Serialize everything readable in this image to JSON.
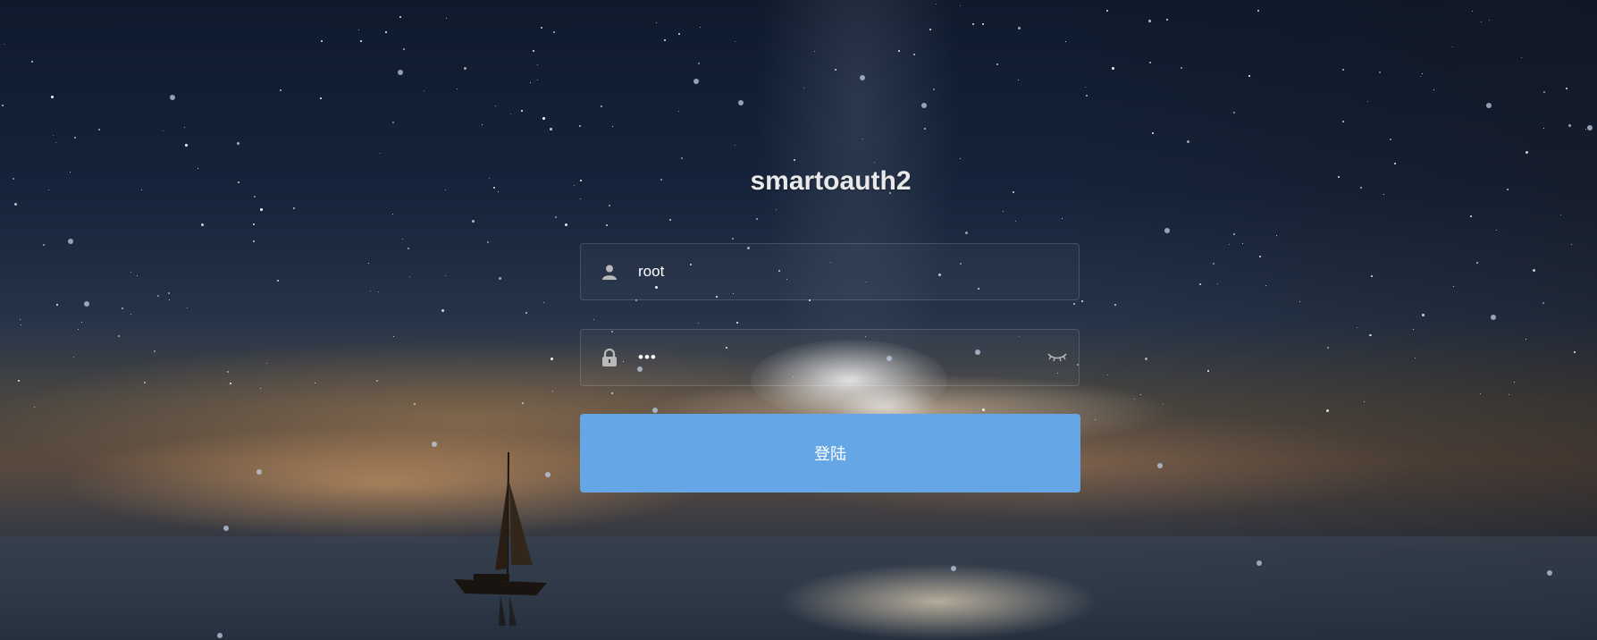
{
  "app": {
    "title": "smartoauth2"
  },
  "login_form": {
    "username": {
      "value": "root",
      "icon": "user-icon"
    },
    "password": {
      "value": "•••",
      "icon": "lock-icon",
      "toggle_icon": "eye-closed-icon"
    },
    "submit_label": "登陆"
  },
  "colors": {
    "button": "#65a6e6",
    "title": "#e9e9e9"
  }
}
